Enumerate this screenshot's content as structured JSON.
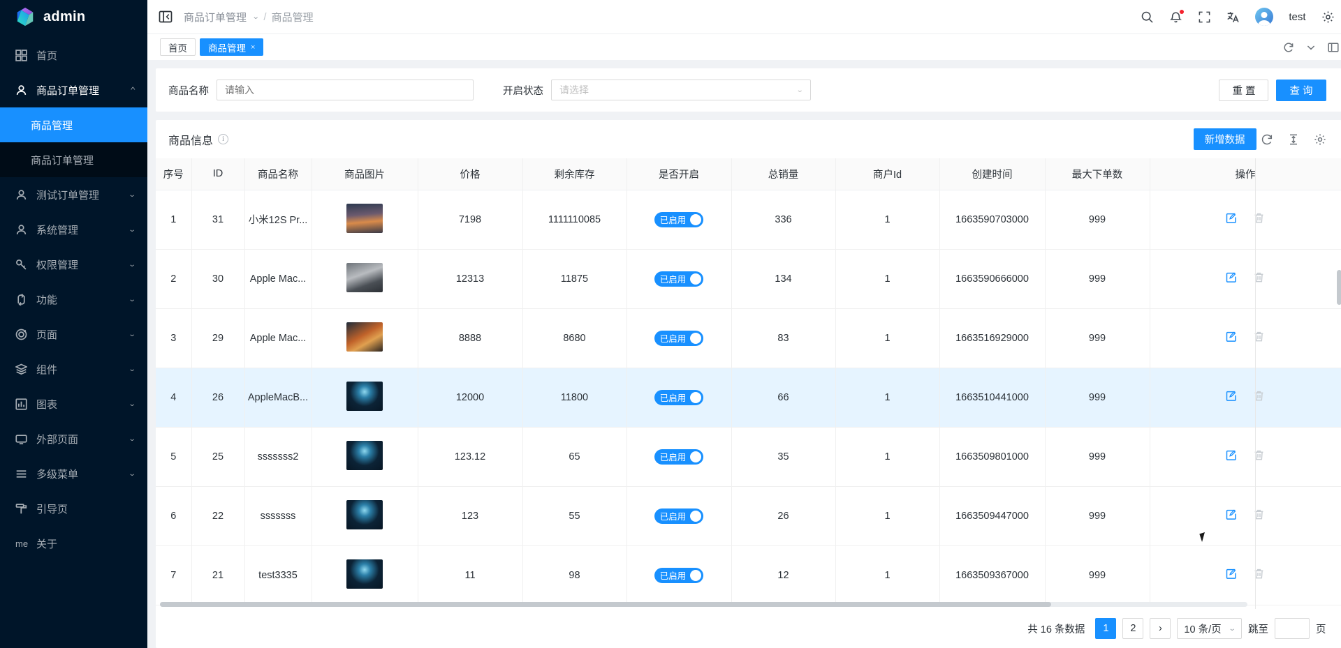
{
  "sidebar": {
    "logo_text": "admin",
    "items": [
      {
        "label": "首页",
        "icon": "dashboard-icon",
        "type": "link"
      },
      {
        "label": "商品订单管理",
        "icon": "user-icon",
        "type": "group",
        "expanded": true,
        "children": [
          {
            "label": "商品管理",
            "active": true
          },
          {
            "label": "商品订单管理",
            "active": false
          }
        ]
      },
      {
        "label": "测试订单管理",
        "icon": "user-icon",
        "type": "group",
        "expanded": false
      },
      {
        "label": "系统管理",
        "icon": "user-icon",
        "type": "group",
        "expanded": false
      },
      {
        "label": "权限管理",
        "icon": "key-icon",
        "type": "group",
        "expanded": false
      },
      {
        "label": "功能",
        "icon": "branch-icon",
        "type": "group",
        "expanded": false
      },
      {
        "label": "页面",
        "icon": "aperture-icon",
        "type": "group",
        "expanded": false
      },
      {
        "label": "组件",
        "icon": "layers-icon",
        "type": "group",
        "expanded": false
      },
      {
        "label": "图表",
        "icon": "bar-chart-icon",
        "type": "group",
        "expanded": false
      },
      {
        "label": "外部页面",
        "icon": "monitor-icon",
        "type": "group",
        "expanded": false
      },
      {
        "label": "多级菜单",
        "icon": "menu-icon",
        "type": "group",
        "expanded": false
      },
      {
        "label": "引导页",
        "icon": "guide-icon",
        "type": "link"
      },
      {
        "label": "关于",
        "icon": "me-icon",
        "type": "link"
      }
    ]
  },
  "header": {
    "collapse_icon": "menu-fold-icon",
    "breadcrumb_root": "商品订单管理",
    "breadcrumb_sep": "/",
    "breadcrumb_current": "商品管理",
    "icons": [
      "search-icon",
      "bell-icon",
      "fullscreen-icon",
      "translate-icon"
    ],
    "username": "test",
    "settings_icon": "gear-icon"
  },
  "tabs": {
    "items": [
      {
        "label": "首页",
        "active": false,
        "closable": false
      },
      {
        "label": "商品管理",
        "active": true,
        "closable": true,
        "close_glyph": "×"
      }
    ],
    "right_icons": [
      "refresh-icon",
      "chevron-down-icon",
      "layout-icon"
    ]
  },
  "filter": {
    "name_label": "商品名称",
    "name_placeholder": "请输入",
    "name_value": "",
    "status_label": "开启状态",
    "status_placeholder": "请选择",
    "status_value": "",
    "reset_label": "重 置",
    "query_label": "查 询"
  },
  "table_panel": {
    "title": "商品信息",
    "info_glyph": "i",
    "add_label": "新增数据",
    "action_icons": [
      "refresh-icon",
      "column-height-icon",
      "setting-icon"
    ]
  },
  "table": {
    "columns": [
      "序号",
      "ID",
      "商品名称",
      "商品图片",
      "价格",
      "剩余库存",
      "是否开启",
      "总销量",
      "商户Id",
      "创建时间",
      "最大下单数",
      "操作"
    ],
    "rows": [
      {
        "index": "1",
        "id": "31",
        "name": "小米12S Pr...",
        "image": "sunset-landscape-thumb",
        "price": "7198",
        "stock": "1111110085",
        "enabled_label": "已启用",
        "enabled": true,
        "sales": "336",
        "merchant_id": "1",
        "created": "1663590703000",
        "max_order": "999",
        "selected": false
      },
      {
        "index": "2",
        "id": "30",
        "name": "Apple Mac...",
        "image": "gray-landscape-thumb",
        "price": "12313",
        "stock": "11875",
        "enabled_label": "已启用",
        "enabled": true,
        "sales": "134",
        "merchant_id": "1",
        "created": "1663590666000",
        "max_order": "999",
        "selected": false
      },
      {
        "index": "3",
        "id": "29",
        "name": "Apple Mac...",
        "image": "orange-landscape-thumb",
        "price": "8888",
        "stock": "8680",
        "enabled_label": "已启用",
        "enabled": true,
        "sales": "83",
        "merchant_id": "1",
        "created": "1663516929000",
        "max_order": "999",
        "selected": false
      },
      {
        "index": "4",
        "id": "26",
        "name": "AppleMacB...",
        "image": "lightning-thumb",
        "price": "12000",
        "stock": "11800",
        "enabled_label": "已启用",
        "enabled": true,
        "sales": "66",
        "merchant_id": "1",
        "created": "1663510441000",
        "max_order": "999",
        "selected": true
      },
      {
        "index": "5",
        "id": "25",
        "name": "sssssss2",
        "image": "lightning-thumb",
        "price": "123.12",
        "stock": "65",
        "enabled_label": "已启用",
        "enabled": true,
        "sales": "35",
        "merchant_id": "1",
        "created": "1663509801000",
        "max_order": "999",
        "selected": false
      },
      {
        "index": "6",
        "id": "22",
        "name": "sssssss",
        "image": "lightning-thumb",
        "price": "123",
        "stock": "55",
        "enabled_label": "已启用",
        "enabled": true,
        "sales": "26",
        "merchant_id": "1",
        "created": "1663509447000",
        "max_order": "999",
        "selected": false
      },
      {
        "index": "7",
        "id": "21",
        "name": "test3335",
        "image": "lightning-thumb",
        "price": "11",
        "stock": "98",
        "enabled_label": "已启用",
        "enabled": true,
        "sales": "12",
        "merchant_id": "1",
        "created": "1663509367000",
        "max_order": "999",
        "selected": false
      }
    ],
    "row_actions": [
      "edit-icon",
      "delete-icon"
    ]
  },
  "pagination": {
    "total_text": "共 16 条数据",
    "pages": [
      "1",
      "2"
    ],
    "current_page": "1",
    "next_glyph": "›",
    "page_size_label": "10 条/页",
    "jump_label": "跳至",
    "jump_value": "",
    "jump_suffix": "页"
  },
  "colors": {
    "primary": "#1890ff",
    "sidebar_bg": "#001529",
    "submenu_bg": "#000c17",
    "selected_row": "#e6f4ff",
    "badge_red": "#f5222d"
  }
}
